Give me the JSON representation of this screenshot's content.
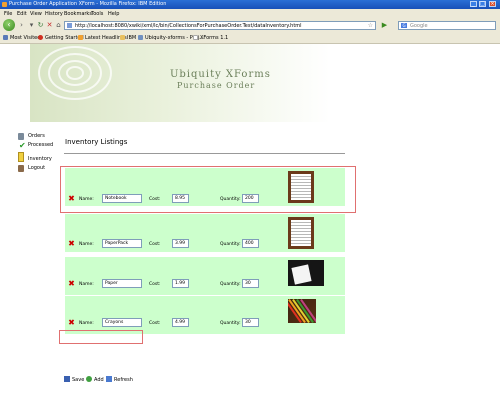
{
  "window": {
    "title": "Purchase Order Application XForm - Mozilla Firefox: IBM Edition",
    "controls": [
      "_",
      "□",
      "×"
    ]
  },
  "menu": [
    "File",
    "Edit",
    "View",
    "History",
    "Bookmarks",
    "Tools",
    "Help"
  ],
  "nav": {
    "url": "http://localhost:8080/xwiki/xml/lc/bin/CollectionsForPurchaseOrder.Test/dataInventory.html",
    "search_placeholder": "Google",
    "search_engine_icon": "G"
  },
  "bookmarks": [
    "Most Visited",
    "Getting Started",
    "Latest Headlines",
    "IBM",
    "Ubiquity-xforms - Proj...",
    "XForms 1.1"
  ],
  "banner": {
    "line1": "Ubiquity XForms",
    "line2": "Purchase Order"
  },
  "sidebar": [
    {
      "label1": "Orders",
      "label2": "Processed"
    },
    {
      "label1": "Inventory",
      "label2": ""
    },
    {
      "label1": "Logout",
      "label2": ""
    }
  ],
  "heading": "Inventory Listings",
  "labels": {
    "name": "Name:",
    "cost": "Cost:",
    "quantity": "Quantity:"
  },
  "items": [
    {
      "name": "Notebook",
      "cost": "8.95",
      "quantity": "200"
    },
    {
      "name": "PaperPack",
      "cost": "3.99",
      "quantity": "400"
    },
    {
      "name": "Paper",
      "cost": "1.99",
      "quantity": "30"
    },
    {
      "name": "Crayons",
      "cost": "4.99",
      "quantity": "30"
    }
  ],
  "toolbar": {
    "save": "Save",
    "add": "Add",
    "refresh": "Refresh"
  },
  "colors": {
    "row_bg": "#ccffcc",
    "highlight": "#e07070",
    "banner_text": "#6b7f5a"
  }
}
